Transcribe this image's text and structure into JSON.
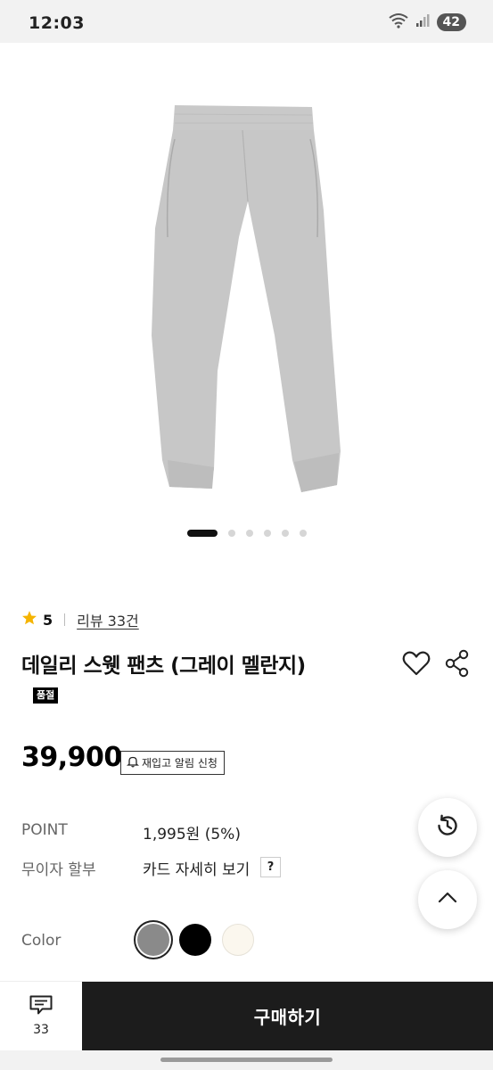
{
  "status_bar": {
    "time": "12:03",
    "battery": "42",
    "icons": [
      "wifi-icon",
      "signal-icon"
    ]
  },
  "carousel": {
    "slide_count": 6,
    "active_index": 0
  },
  "product": {
    "rating": "5",
    "review_link": "리뷰 33건",
    "title": "데일리 스웻 팬츠 (그레이 멜란지)",
    "badge": "품절",
    "price": "39,900",
    "restock_label": "재입고 알림 신청"
  },
  "info": {
    "point_label": "POINT",
    "point_value": "1,995원 (5%)",
    "installment_label": "무이자 할부",
    "installment_value": "카드 자세히 보기",
    "help_label": "?"
  },
  "color_section": {
    "label": "Color",
    "options": [
      "#8a8a8a",
      "#000000",
      "#fbf7ee"
    ],
    "selected_index": 0
  },
  "bottom_bar": {
    "review_count": "33",
    "buy_label": "구매하기"
  },
  "colors": {
    "star": "#f5b400",
    "buy_button": "#1c1c1c",
    "pants": "#c7c7c7"
  }
}
